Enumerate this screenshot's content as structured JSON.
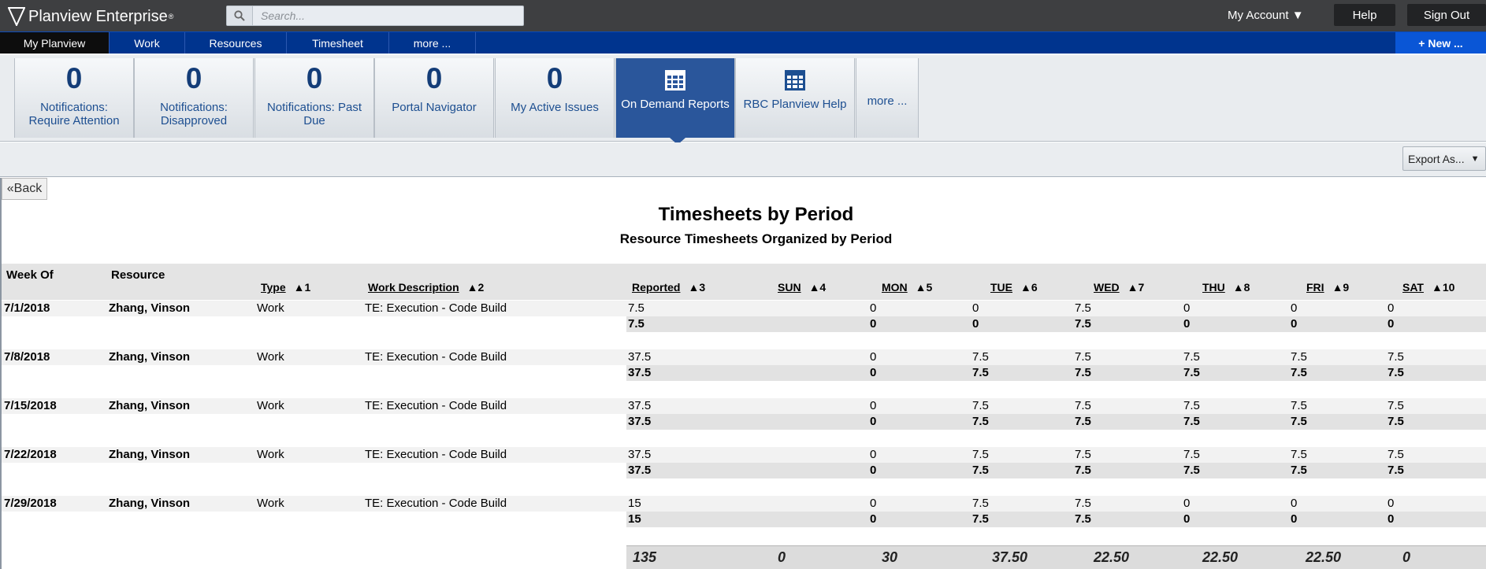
{
  "app": {
    "name": "Planview Enterprise",
    "search_placeholder": "Search...",
    "my_account": "My Account ▼",
    "help": "Help",
    "sign_out": "Sign Out"
  },
  "nav": {
    "items": [
      "My Planview",
      "Work",
      "Resources",
      "Timesheet",
      "more ..."
    ],
    "new_label": "+ New ..."
  },
  "tiles": [
    {
      "count": "0",
      "label": "Notifications: Require Attention"
    },
    {
      "count": "0",
      "label": "Notifications: Disapproved"
    },
    {
      "count": "0",
      "label": "Notifications: Past Due"
    },
    {
      "count": "0",
      "label": "Portal Navigator"
    },
    {
      "count": "0",
      "label": "My Active Issues"
    },
    {
      "label": "On Demand Reports",
      "icon": "grid-report-icon"
    },
    {
      "label": "RBC Planview Help",
      "icon": "grid-report-icon"
    },
    {
      "label": "more ..."
    }
  ],
  "toolbar": {
    "export_label": "Export As..."
  },
  "report": {
    "back_label": "«Back",
    "title": "Timesheets by Period",
    "subtitle": "Resource Timesheets Organized by Period",
    "group_headers": [
      "Week Of",
      "Resource"
    ],
    "columns": [
      {
        "label": "Type",
        "sort": "1"
      },
      {
        "label": "Work Description",
        "sort": "2"
      },
      {
        "label": "Reported",
        "sort": "3"
      },
      {
        "label": "SUN",
        "sort": "4"
      },
      {
        "label": "MON",
        "sort": "5"
      },
      {
        "label": "TUE",
        "sort": "6"
      },
      {
        "label": "WED",
        "sort": "7"
      },
      {
        "label": "THU",
        "sort": "8"
      },
      {
        "label": "FRI",
        "sort": "9"
      },
      {
        "label": "SAT",
        "sort": "10"
      }
    ],
    "rows": [
      {
        "week": "7/1/2018",
        "resource": "Zhang, Vinson",
        "type": "Work",
        "desc": "TE: Execution - Code Build",
        "reported": "7.5",
        "days": [
          "0",
          "0",
          "7.5",
          "0",
          "0",
          "0"
        ],
        "sub_reported": "7.5",
        "sub_days": [
          "0",
          "0",
          "7.5",
          "0",
          "0",
          "0"
        ]
      },
      {
        "week": "7/8/2018",
        "resource": "Zhang, Vinson",
        "type": "Work",
        "desc": "TE: Execution - Code Build",
        "reported": "37.5",
        "days": [
          "0",
          "7.5",
          "7.5",
          "7.5",
          "7.5",
          "7.5"
        ],
        "sub_reported": "37.5",
        "sub_days": [
          "0",
          "7.5",
          "7.5",
          "7.5",
          "7.5",
          "7.5"
        ]
      },
      {
        "week": "7/15/2018",
        "resource": "Zhang, Vinson",
        "type": "Work",
        "desc": "TE: Execution - Code Build",
        "reported": "37.5",
        "days": [
          "0",
          "7.5",
          "7.5",
          "7.5",
          "7.5",
          "7.5"
        ],
        "sub_reported": "37.5",
        "sub_days": [
          "0",
          "7.5",
          "7.5",
          "7.5",
          "7.5",
          "7.5"
        ]
      },
      {
        "week": "7/22/2018",
        "resource": "Zhang, Vinson",
        "type": "Work",
        "desc": "TE: Execution - Code Build",
        "reported": "37.5",
        "days": [
          "0",
          "7.5",
          "7.5",
          "7.5",
          "7.5",
          "7.5"
        ],
        "sub_reported": "37.5",
        "sub_days": [
          "0",
          "7.5",
          "7.5",
          "7.5",
          "7.5",
          "7.5"
        ]
      },
      {
        "week": "7/29/2018",
        "resource": "Zhang, Vinson",
        "type": "Work",
        "desc": "TE: Execution - Code Build",
        "reported": "15",
        "days": [
          "0",
          "7.5",
          "7.5",
          "0",
          "0",
          "0"
        ],
        "sub_reported": "15",
        "sub_days": [
          "0",
          "7.5",
          "7.5",
          "0",
          "0",
          "0"
        ]
      }
    ],
    "totals": [
      "135",
      "0",
      "30",
      "37.50",
      "22.50",
      "22.50",
      "22.50",
      "0"
    ]
  }
}
